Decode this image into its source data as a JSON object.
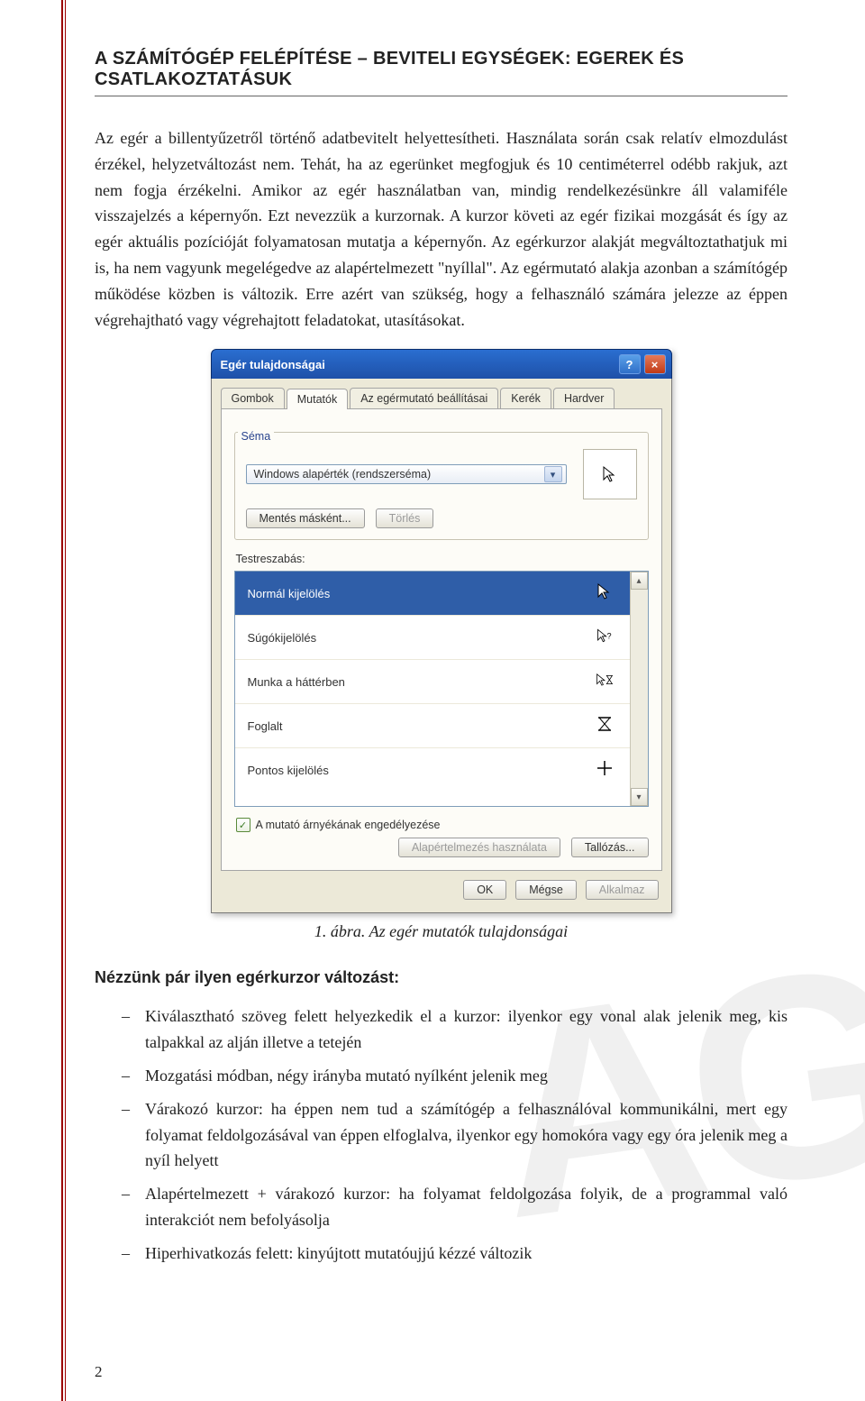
{
  "header": {
    "title": "A SZÁMÍTÓGÉP FELÉPÍTÉSE – BEVITELI EGYSÉGEK: EGEREK ÉS CSATLAKOZTATÁSUK"
  },
  "paragraph": "Az egér a billentyűzetről történő adatbevitelt helyettesítheti. Használata során csak relatív elmozdulást érzékel, helyzetváltozást nem. Tehát, ha az egerünket megfogjuk és 10 centiméterrel odébb rakjuk, azt nem fogja érzékelni. Amikor az egér használatban van, mindig rendelkezésünkre áll valamiféle visszajelzés a képernyőn. Ezt nevezzük a kurzornak. A kurzor követi az egér fizikai mozgását és így az egér aktuális pozícióját folyamatosan mutatja a képernyőn. Az egérkurzor alakját megváltoztathatjuk mi is, ha nem vagyunk megelégedve az alapértelmezett \"nyíllal\". Az egérmutató alakja azonban a számítógép működése közben is változik. Erre azért van szükség, hogy a felhasználó számára jelezze az éppen végrehajtható vagy végrehajtott feladatokat, utasításokat.",
  "dialog": {
    "title": "Egér tulajdonságai",
    "help": "?",
    "close": "×",
    "tabs": [
      "Gombok",
      "Mutatók",
      "Az egérmutató beállításai",
      "Kerék",
      "Hardver"
    ],
    "active_tab_index": 1,
    "scheme_label": "Séma",
    "scheme_value": "Windows alapérték (rendszerséma)",
    "save_as": "Mentés másként...",
    "delete": "Törlés",
    "customize_label": "Testreszabás:",
    "list": [
      {
        "label": "Normál kijelölés",
        "icon": "arrow",
        "selected": true
      },
      {
        "label": "Súgókijelölés",
        "icon": "arrow-help",
        "selected": false
      },
      {
        "label": "Munka a háttérben",
        "icon": "arrow-hourglass",
        "selected": false
      },
      {
        "label": "Foglalt",
        "icon": "hourglass",
        "selected": false
      },
      {
        "label": "Pontos kijelölés",
        "icon": "cross",
        "selected": false
      }
    ],
    "shadow_check": "A mutató árnyékának engedélyezése",
    "shadow_checked": true,
    "use_default": "Alapértelmezés használata",
    "browse": "Tallózás...",
    "ok": "OK",
    "cancel": "Mégse",
    "apply": "Alkalmaz"
  },
  "figure_caption": "1. ábra. Az egér mutatók tulajdonságai",
  "subheading": "Nézzünk pár ilyen egérkurzor változást:",
  "bullets": [
    "Kiválasztható szöveg felett helyezkedik el a kurzor: ilyenkor egy vonal alak jelenik meg, kis talpakkal az alján illetve a tetején",
    "Mozgatási módban, négy irányba mutató nyílként jelenik meg",
    "Várakozó kurzor: ha éppen nem tud a számítógép a felhasználóval kommunikálni, mert egy folyamat feldolgozásával van éppen elfoglalva, ilyenkor egy homokóra vagy egy óra jelenik meg a nyíl helyett",
    "Alapértelmezett + várakozó kurzor: ha folyamat feldolgozása folyik, de a programmal való interakciót nem befolyásolja",
    "Hiperhivatkozás felett: kinyújtott mutatóujjú kézzé változik"
  ],
  "page_number": "2",
  "watermark_partial": "AG"
}
